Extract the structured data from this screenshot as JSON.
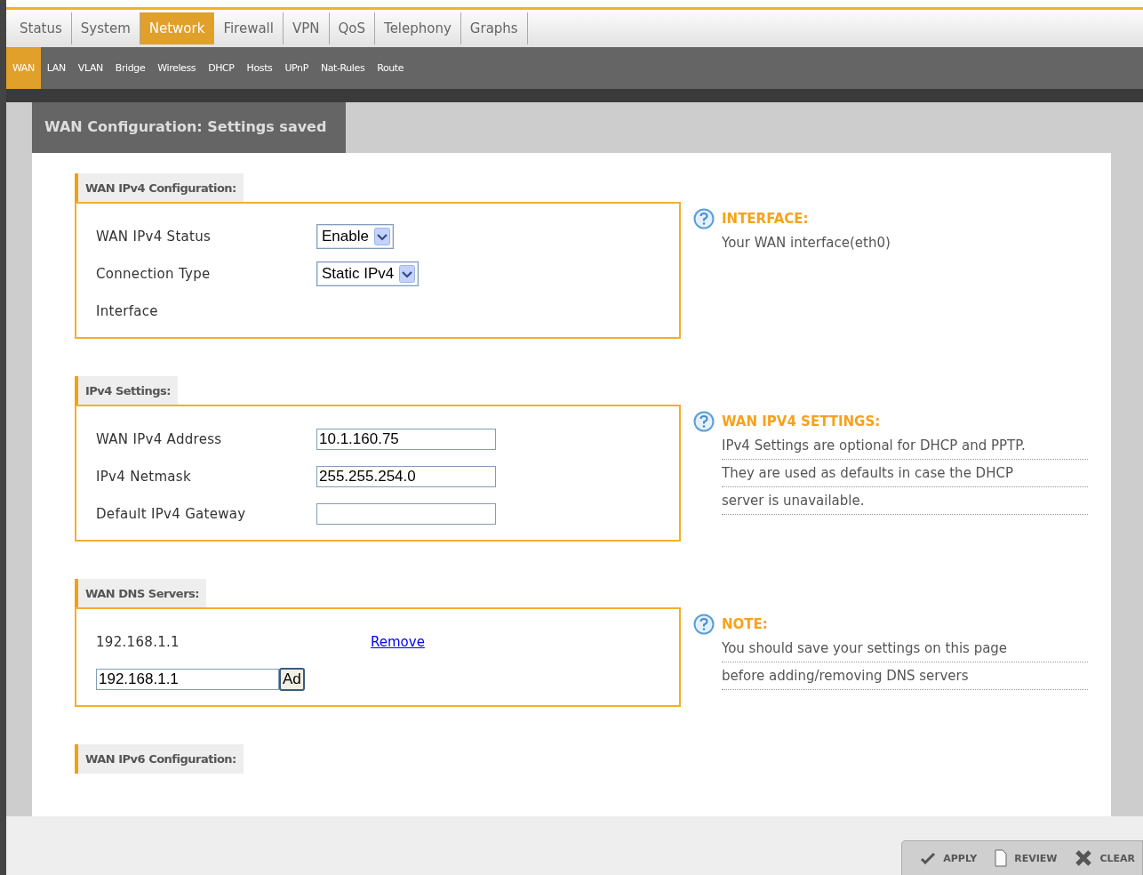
{
  "tabs": [
    {
      "label": "Status",
      "selected": false
    },
    {
      "label": "System",
      "selected": false
    },
    {
      "label": "Network",
      "selected": true
    },
    {
      "label": "Firewall",
      "selected": false
    },
    {
      "label": "VPN",
      "selected": false
    },
    {
      "label": "QoS",
      "selected": false
    },
    {
      "label": "Telephony",
      "selected": false
    },
    {
      "label": "Graphs",
      "selected": false
    }
  ],
  "subtabs": [
    {
      "label": "WAN",
      "selected": true
    },
    {
      "label": "LAN",
      "selected": false
    },
    {
      "label": "VLAN",
      "selected": false
    },
    {
      "label": "Bridge",
      "selected": false
    },
    {
      "label": "Wireless",
      "selected": false
    },
    {
      "label": "DHCP",
      "selected": false
    },
    {
      "label": "Hosts",
      "selected": false
    },
    {
      "label": "UPnP",
      "selected": false
    },
    {
      "label": "Nat-Rules",
      "selected": false
    },
    {
      "label": "Route",
      "selected": false
    }
  ],
  "page_title": "WAN Configuration: Settings saved",
  "sections": [
    {
      "title": "WAN IPv4 Configuration:",
      "rows": [
        {
          "kind": "select",
          "label": "WAN IPv4 Status",
          "value": "Enable"
        },
        {
          "kind": "select",
          "label": "Connection Type",
          "value": "Static IPv4"
        },
        {
          "kind": "static",
          "label": "Interface"
        }
      ],
      "help": {
        "title": "INTERFACE:",
        "lines": [
          "Your WAN interface(eth0)"
        ],
        "dotted": false
      }
    },
    {
      "title": "IPv4 Settings:",
      "rows": [
        {
          "kind": "input",
          "label": "WAN IPv4 Address",
          "value": "10.1.160.75"
        },
        {
          "kind": "input",
          "label": "IPv4 Netmask",
          "value": "255.255.254.0"
        },
        {
          "kind": "input",
          "label": "Default IPv4 Gateway"
        }
      ],
      "help": {
        "title": "WAN IPV4 SETTINGS:",
        "lines": [
          "IPv4 Settings are optional for DHCP and PPTP.",
          "They are used as defaults in case the DHCP",
          "server is unavailable."
        ],
        "dotted": true
      }
    },
    {
      "title": "WAN DNS Servers:",
      "rows": [
        {
          "kind": "dns",
          "label": "192.168.1.1",
          "link": "Remove"
        },
        {
          "kind": "add",
          "value": "192.168.1.1",
          "button": "Ad"
        }
      ],
      "help": {
        "title": "NOTE:",
        "lines": [
          "You should save your settings on this page",
          "before adding/removing DNS servers"
        ],
        "dotted": true
      }
    },
    {
      "title": "WAN IPv6 Configuration:"
    }
  ],
  "actions": [
    {
      "kind": "apply",
      "label": "APPLY"
    },
    {
      "kind": "review",
      "label": "REVIEW"
    },
    {
      "kind": "clear",
      "label": "CLEAR"
    }
  ]
}
